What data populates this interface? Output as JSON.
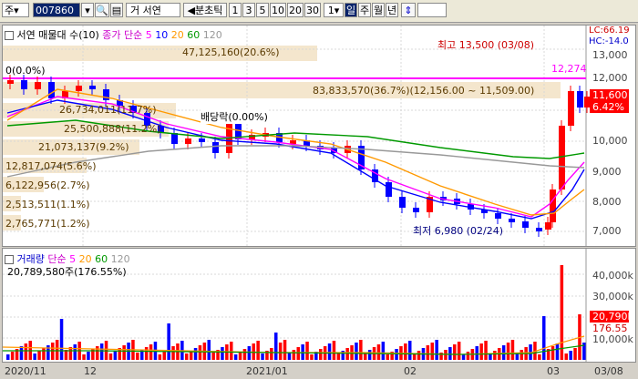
{
  "toolbar": {
    "market": "주",
    "code": "007860",
    "company": "서연",
    "mode": "분초틱",
    "intervals": [
      "1",
      "3",
      "5",
      "10",
      "20",
      "30"
    ],
    "count": "1",
    "periods": [
      "일",
      "주",
      "월",
      "년"
    ],
    "active_period": "일"
  },
  "price_panel": {
    "title": "서연 매물대 수(10)",
    "ma_label": "종가 단순",
    "ma_periods": [
      "5",
      "10",
      "20",
      "60",
      "120"
    ],
    "corner_lc": "LC:66.19",
    "corner_hc": "HC:-14.0",
    "pink_line_label": "0(0.0%)",
    "pink_line_value": "12,274",
    "high_annotation": "최고 13,500 (03/08)",
    "low_annotation": "최저 6,980 (02/24)",
    "dividend_annotation": "배당락(0.00%)",
    "current_price": "11,600",
    "current_pct": "6.42%",
    "y_ticks": [
      "13,000",
      "12,000",
      "11,000",
      "10,000",
      "9,000",
      "8,000",
      "7,000"
    ],
    "volume_profile": [
      {
        "label": "47,125,160(20.6%)"
      },
      {
        "label": "83,833,570(36.7%)(12,156.00 ~ 11,509.00)"
      },
      {
        "label": "26,734,011(11.7%)"
      },
      {
        "label": "25,500,888(11.2%)"
      },
      {
        "label": "21,073,137(9.2%)"
      },
      {
        "label": "12,817,074(5.6%)"
      },
      {
        "label": "6,122,956(2.7%)"
      },
      {
        "label": "2,513,511(1.1%)"
      },
      {
        "label": "2,765,771(1.2%)"
      }
    ]
  },
  "volume_panel": {
    "title": "거래량",
    "ma_label": "단순",
    "ma_periods": [
      "5",
      "20",
      "60",
      "120"
    ],
    "last_volume": "20,789,580주(176.55%)",
    "y_ticks": [
      "40,000k",
      "30,000k",
      "20,000k",
      "10,000k"
    ],
    "current_volume": "20,790k",
    "current_pct": "176.55"
  },
  "x_axis": [
    "2020/11",
    "12",
    "2021/01",
    "02",
    "03",
    "03/08"
  ],
  "colors": {
    "up": "#ff0000",
    "down": "#0000ff",
    "pink": "#ff00ff",
    "ma5": "#ff00ff",
    "ma10": "#0000ff",
    "ma20": "#ff9900",
    "ma60": "#009900",
    "ma120": "#999999",
    "navy": "#000080"
  }
}
